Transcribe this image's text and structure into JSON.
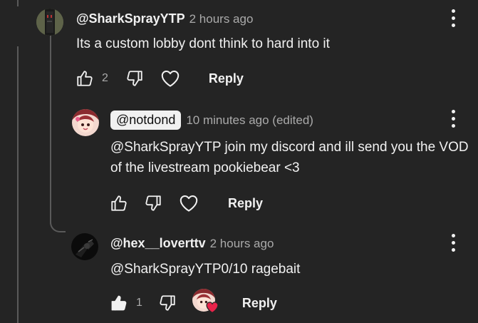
{
  "comments": [
    {
      "author": "@SharkSprayYTP",
      "timestamp": "2 hours ago",
      "text": "Its a custom lobby dont think to hard into it",
      "like_count": "2",
      "reply_label": "Reply",
      "avatar": "dark-figure-avatar"
    },
    {
      "author": "@notdond",
      "timestamp": "10 minutes ago (edited)",
      "text": "@SharkSprayYTP join my discord and ill send you the VOD of the livestream pookiebear <3",
      "reply_label": "Reply",
      "author_is_creator": true,
      "avatar": "anime-girl-avatar"
    },
    {
      "author": "@hex__loverttv",
      "timestamp": "2 hours ago",
      "text": "@SharkSprayYTP0/10 ragebait",
      "like_count": "1",
      "reply_label": "Reply",
      "liked": true,
      "creator_hearted": true,
      "avatar": "dark-figure-avatar"
    }
  ],
  "colors": {
    "background": "#242424",
    "text": "#f1f1f1",
    "muted": "#aaaaaa",
    "thread_line": "#5a5a5a",
    "heart_badge": "#e8234a"
  },
  "icons": [
    "thumb-up-icon",
    "thumb-down-icon",
    "heart-icon",
    "more-vert-icon",
    "creator-heart-badge-icon"
  ]
}
